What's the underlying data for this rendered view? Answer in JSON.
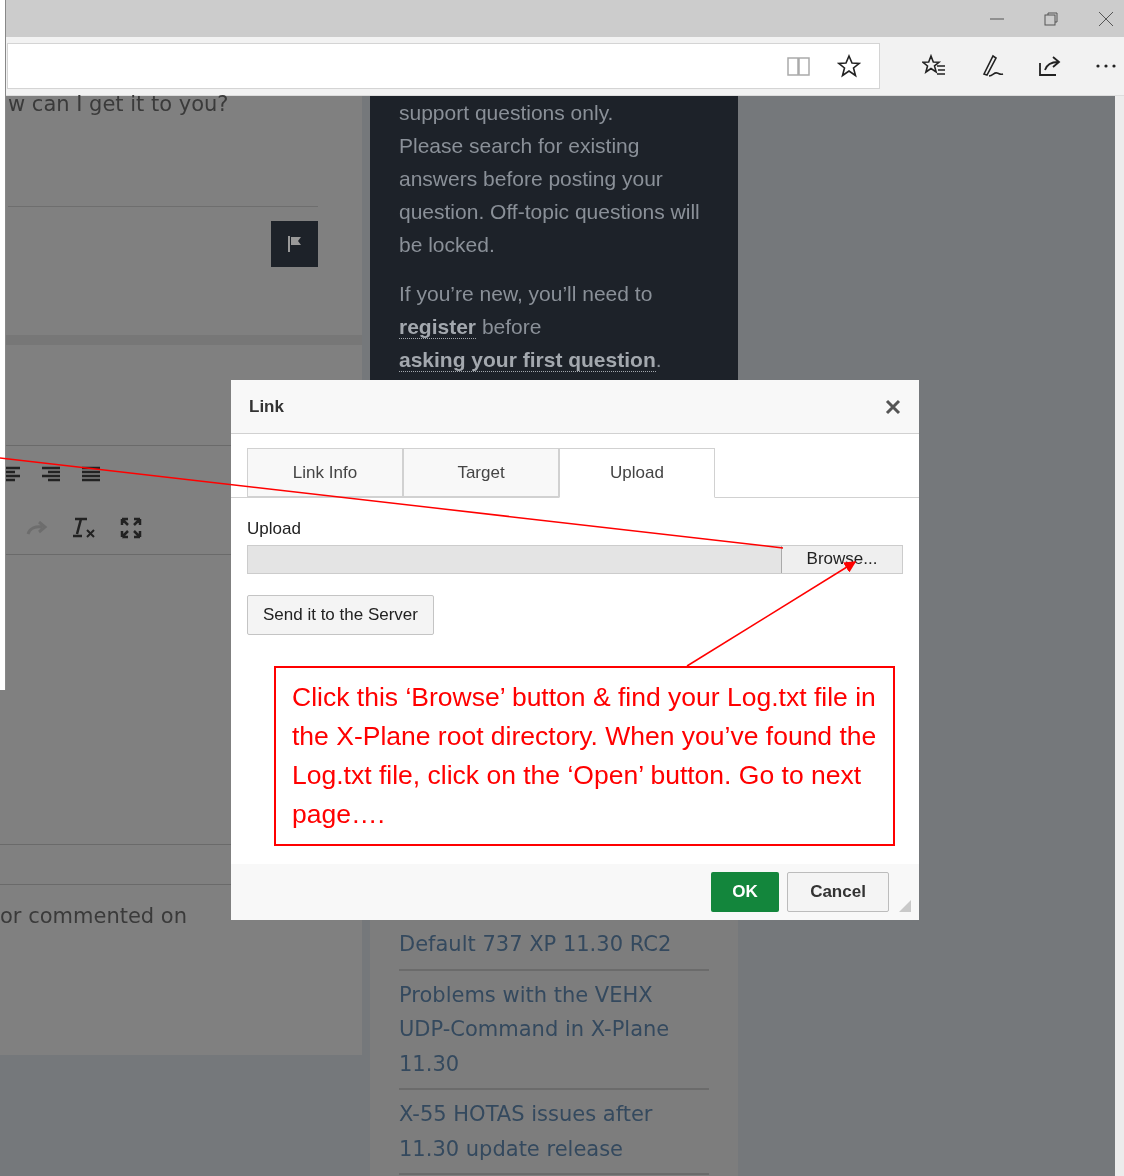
{
  "page": {
    "question_text": "w can I get it to you?",
    "activity_text": "or commented on",
    "notice_lines": [
      "support questions only.",
      "Please search for existing answers before posting your question. Off-topic questions will be locked."
    ],
    "notice_parts": [
      {
        "text": "If you’re new, you’ll need to ",
        "link": false
      },
      {
        "text": "register",
        "link": true
      },
      {
        "text": " before ",
        "link": false
      },
      {
        "text": "asking your first question",
        "link": true
      },
      {
        "text": ".",
        "link": false
      }
    ],
    "topics": [
      "Default 737 XP 11.30 RC2",
      "Problems with the VEHX UDP-Command in X-Plane 11.30",
      "X-55 HOTAS issues after 11.30 update release"
    ]
  },
  "dialog": {
    "title": "Link",
    "tabs": [
      {
        "label": "Link Info",
        "selected": false
      },
      {
        "label": "Target",
        "selected": false
      },
      {
        "label": "Upload",
        "selected": true
      }
    ],
    "upload_label": "Upload",
    "browse_button": "Browse...",
    "send_button": "Send it to the Server",
    "ok_button": "OK",
    "cancel_button": "Cancel"
  },
  "annotation": {
    "text": "Click this ‘Browse’ button & find your Log.txt file in the X-Plane root directory. When you’ve found the Log.txt file, click on the ‘Open’ button. Go to next page…."
  }
}
